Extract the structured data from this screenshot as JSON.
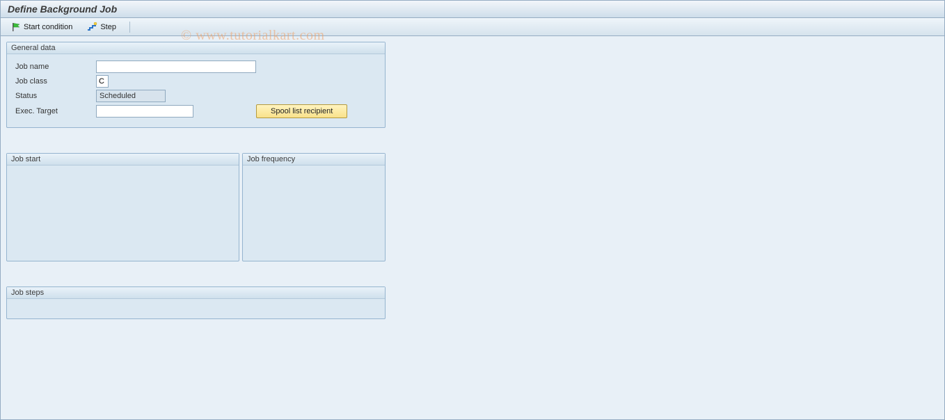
{
  "title": "Define Background Job",
  "toolbar": {
    "start_condition": "Start condition",
    "step": "Step"
  },
  "general": {
    "group_title": "General data",
    "job_name_label": "Job name",
    "job_name_value": "",
    "job_class_label": "Job class",
    "job_class_value": "C",
    "status_label": "Status",
    "status_value": "Scheduled",
    "exec_target_label": "Exec. Target",
    "exec_target_value": "",
    "spool_button": "Spool list recipient"
  },
  "job_start": {
    "title": "Job start"
  },
  "job_frequency": {
    "title": "Job frequency"
  },
  "job_steps": {
    "title": "Job steps"
  },
  "watermark": "© www.tutorialkart.com"
}
